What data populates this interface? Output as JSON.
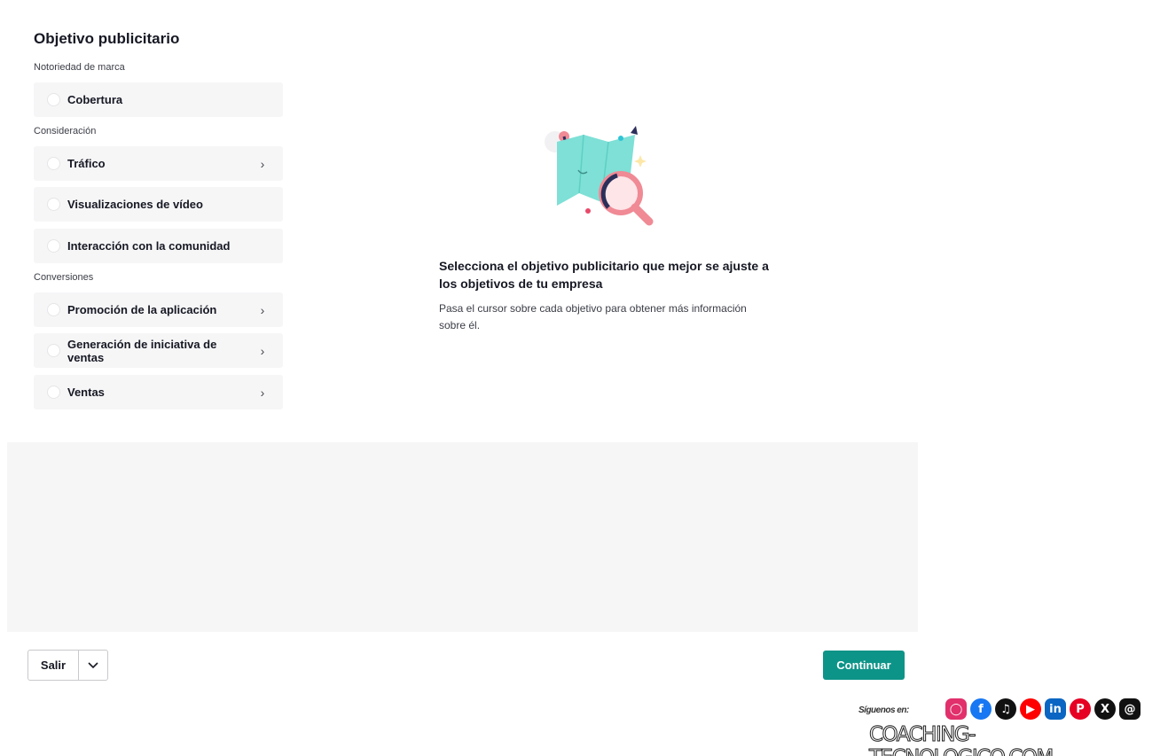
{
  "objective": {
    "title": "Objetivo publicitario",
    "groups": [
      {
        "label": "Notoriedad de marca",
        "options": [
          {
            "label": "Cobertura",
            "has_submenu": false
          }
        ]
      },
      {
        "label": "Consideración",
        "options": [
          {
            "label": "Tráfico",
            "has_submenu": true
          },
          {
            "label": "Visualizaciones de vídeo",
            "has_submenu": false
          },
          {
            "label": "Interacción con la comunidad",
            "has_submenu": false
          }
        ]
      },
      {
        "label": "Conversiones",
        "options": [
          {
            "label": "Promoción de la aplicación",
            "has_submenu": true
          },
          {
            "label": "Generación de iniciativa de ventas",
            "has_submenu": true
          },
          {
            "label": "Ventas",
            "has_submenu": true
          }
        ]
      }
    ]
  },
  "info": {
    "heading": "Selecciona el objetivo publicitario que mejor se ajuste a los objetivos de tu empresa",
    "body": "Pasa el cursor sobre cada objetivo para obtener más información sobre él."
  },
  "footer": {
    "exit_label": "Salir",
    "continue_label": "Continuar"
  },
  "watermark": {
    "follow_label": "Síguenos en:",
    "site": "COACHING-TECNOLOGICO.COM",
    "icons": [
      "instagram-icon",
      "facebook-icon",
      "tiktok-icon",
      "youtube-icon",
      "linkedin-icon",
      "pinterest-icon",
      "x-icon",
      "threads-icon"
    ]
  },
  "colors": {
    "accent": "#0d9488",
    "option_bg": "#f6f6f7"
  }
}
